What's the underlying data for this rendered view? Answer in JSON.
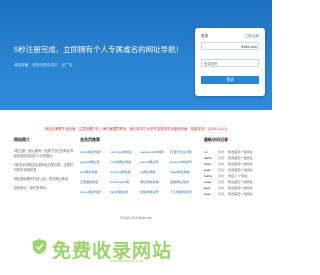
{
  "hero": {
    "title": "5秒注册完成，立即拥有个人专属或名的网址导航！",
    "links": [
      "网址收藏",
      "网站分类自定义",
      "无广告"
    ]
  },
  "login": {
    "label": "登录",
    "register": "立即注册",
    "domain": ".5z5d.com",
    "password_placeholder": "登录密码",
    "button": "登录"
  },
  "notice": "网站已满载于该页面，注意设置只在上海与管理员联系，我们将尽力为您开发更多的功能和页面，感谢支持！(2015-11-01)",
  "about": {
    "title": "网站简介",
    "paragraphs": [
      "5秒注册，随心拥有一张属于自己的网址导航页面支持自定义分类网址",
      "5秒完全可随意定制网址分类目录，无需任何软件设置标签",
      "网址保存随时在线上阅，首页随心即用",
      "找到就记，我们来帮你。"
    ]
  },
  "recommend": {
    "title": "会员页推荐",
    "items": [
      "sunlin网址导航",
      "melingyu的网址",
      "gagajiang1986网",
      "石瀑艺术设计网",
      "ggrefoli网址导",
      "YJC的网址导航",
      "learnyl网址导",
      "jason123网址导",
      "lwsl网址导航",
      "wenbing网址导",
      "xg网址导航",
      "aaaw网址导航",
      "王春爱的网址",
      "xinzhengde网",
      "网址导航系统",
      "追旗网址导航",
      "jinyue网址导航",
      "ftldy的网址导",
      "奶奶的网址导",
      "个人导航网址导"
    ]
  },
  "latest": {
    "title": "最新访问记录",
    "rows": [
      {
        "name": "nn",
        "when": "刚刚",
        "text": "修改首页个性网址"
      },
      {
        "name": "alpha",
        "when": "刚刚",
        "text": "修改首页个性网址"
      },
      {
        "name": "devin",
        "when": "刚刚",
        "text": "修改首页个性网址"
      },
      {
        "name": "dodo",
        "when": "刚刚",
        "text": "修改首页个性网址"
      },
      {
        "name": "bobby",
        "when": "刚刚",
        "text": "添加了 个网址"
      },
      {
        "name": "dmax",
        "when": "刚刚",
        "text": "修改首页个性网址"
      },
      {
        "name": "kelly",
        "when": "刚刚",
        "text": "修改首页个性网址"
      },
      {
        "name": "slow",
        "when": "刚刚",
        "text": "修改首页个性网址"
      }
    ]
  },
  "footer": "©2008-2016 5z5d.com",
  "watermark": {
    "text": "免费收录网站",
    "sub": "mianfeishoulu.com"
  },
  "colors": {
    "hero": "#2a84d2",
    "notice": "#d02d2d",
    "link": "#2a6fb3",
    "watermark": "#9bd46a"
  }
}
